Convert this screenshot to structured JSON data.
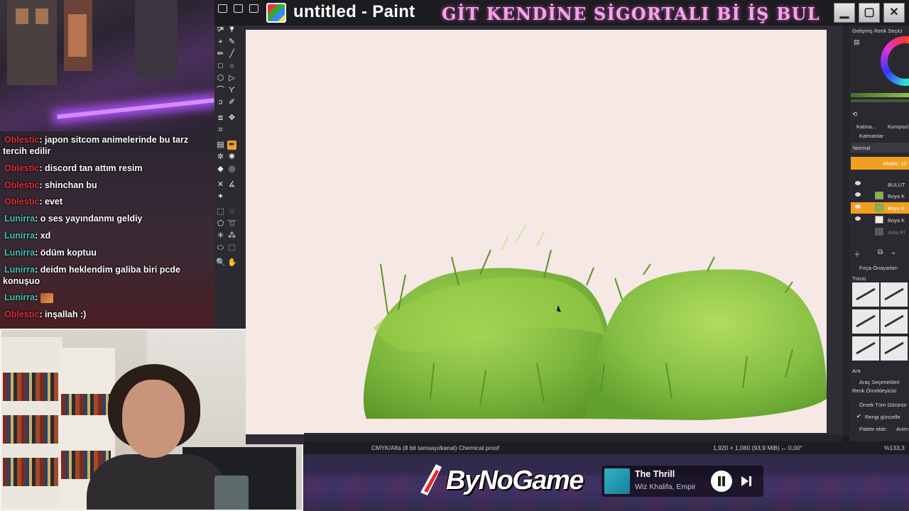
{
  "window": {
    "title": "untitled - Paint",
    "banner": "GİT KENDİNE SİGORTALI Bİ İŞ BUL",
    "buttons": {
      "minimize": "▁",
      "maximize": "▢",
      "close": "✕"
    }
  },
  "chat": {
    "messages": [
      {
        "user": "Oblestic",
        "text": ": japon sitcom animelerinde bu tarz tercih edilir",
        "color": "#e0303a"
      },
      {
        "user": "Oblestic",
        "text": ": discord tan attım resim",
        "color": "#e0303a"
      },
      {
        "user": "Oblestic",
        "text": ": shinchan bu",
        "color": "#e0303a"
      },
      {
        "user": "Oblestic",
        "text": ": evet",
        "color": "#e0303a"
      },
      {
        "user": "Lunirra",
        "text": ": o ses yayındanmı geldiy",
        "color": "#3fc7b6"
      },
      {
        "user": "Lunirra",
        "text": ": xd",
        "color": "#3fc7b6"
      },
      {
        "user": "Lunirra",
        "text": ": ödüm koptuu",
        "color": "#3fc7b6"
      },
      {
        "user": "Lunirra",
        "text": ": deidm heklendim galiba biri pcde konuşuo",
        "color": "#3fc7b6"
      },
      {
        "user": "Lunirra",
        "text": ":",
        "color": "#3fc7b6",
        "emote": true
      },
      {
        "user": "Oblestic",
        "text": ": inşallah :)",
        "color": "#e0303a"
      }
    ]
  },
  "status_bar": {
    "color_mode": "CMYK/Alfa (8 bit tamsayı/kanal) Chemical proof",
    "dimensions": "1,920 × 1,080 (93,9 MiB)",
    "angle": "↔ 0,00°",
    "zoom": "%133,3"
  },
  "panel": {
    "color_selector": "Gelişmiş Renk Seçici",
    "tab_layers": "Katma...",
    "tab_compose": "Kompozi",
    "layers_title": "Katmanlar",
    "blend_mode": "Normal",
    "opacity": "Matlık: 10",
    "layers": [
      "BULUT",
      "Boya K",
      "Boya K",
      "Boya K",
      "Arka Pl"
    ],
    "brush_presets": "Fırça Önayarları",
    "brush_filter": "Tümü",
    "search": "Ara",
    "tool_options": "Araç Seçenekleri",
    "color_sampler": "Renk Örnekleyicisi",
    "sample_option": "Örnek Tüm Görünür",
    "update_color": "Rengi güncelle",
    "palette_add": "Palete ekle:",
    "palette_mode": "Anim"
  },
  "music": {
    "song": "The Thrill",
    "artist": "Wiz Khalifa, Empire"
  },
  "brand": {
    "name": "ByNoGame"
  },
  "colors": {
    "accent": "#f0a020",
    "grass_dark": "#5e9a2a",
    "grass_light": "#9ccf4a",
    "canvas": "#f6e8e4"
  }
}
